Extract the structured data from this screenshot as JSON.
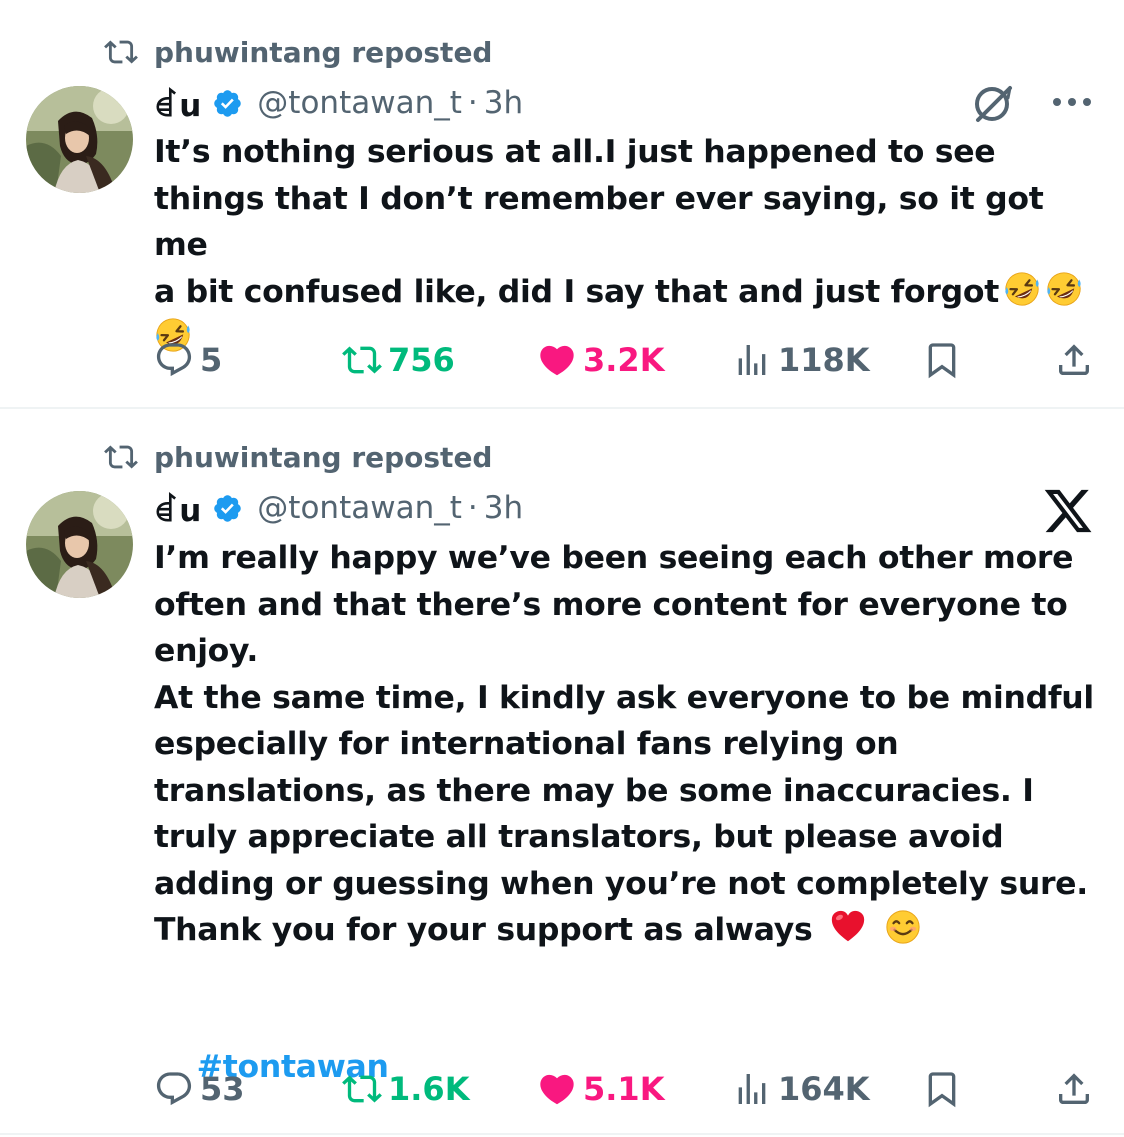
{
  "tweets": [
    {
      "repost_label": "phuwintang reposted",
      "display_name": "ꀸu",
      "handle": "@tontawan_t",
      "separator": "·",
      "time": "3h",
      "text": "It’s nothing serious at all.I just happened to see\nthings that I don’t remember ever saying, so it got me\na bit confused like, did I say that and just forgot",
      "emojis": [
        "rolling-on-floor-laughing",
        "rolling-on-floor-laughing",
        "rolling-on-floor-laughing"
      ],
      "stats": {
        "replies": "5",
        "reposts": "756",
        "likes": "3.2K",
        "views": "118K"
      },
      "top_right_icons": [
        "grok-icon",
        "more-icon"
      ]
    },
    {
      "repost_label": "phuwintang reposted",
      "display_name": "ꀸu",
      "handle": "@tontawan_t",
      "separator": "·",
      "time": "3h",
      "text": "I’m really happy we’ve been seeing each other more\noften and that there’s more content for everyone to\nenjoy.\nAt the same time, I kindly ask everyone to be mindful\nespecially for international fans relying on\ntranslations, as there may be some inaccuracies. I\ntruly appreciate all translators, but please avoid\nadding or guessing when you’re not completely sure.\nThank you for your support as always",
      "emojis": [
        "red-heart",
        "smiling-face"
      ],
      "hashtag": "#tontawan",
      "stats": {
        "replies": "53",
        "reposts": "1.6K",
        "likes": "5.1K",
        "views": "164K"
      },
      "top_right_icons": [
        "x-logo-icon"
      ]
    }
  ],
  "colors": {
    "text": "#0f1419",
    "secondary": "#536471",
    "repost_green": "#00ba7c",
    "like_pink": "#f91880",
    "link_blue": "#1d9bf0",
    "verified_blue": "#1d9bf0"
  }
}
